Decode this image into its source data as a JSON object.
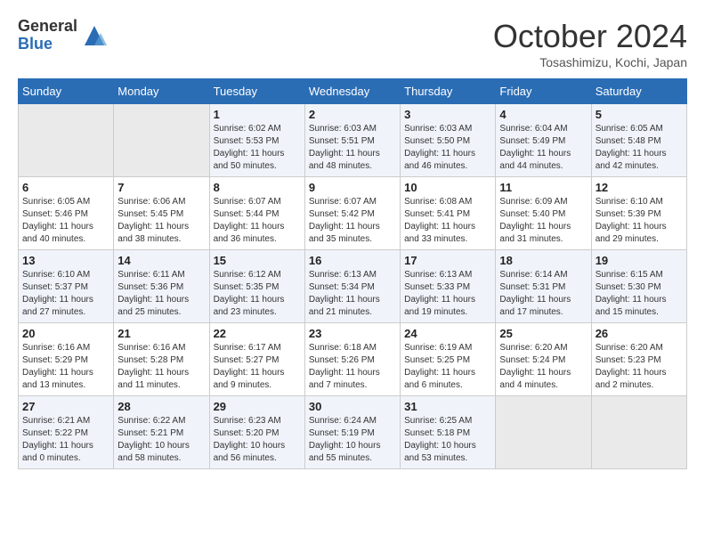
{
  "logo": {
    "general": "General",
    "blue": "Blue"
  },
  "title": "October 2024",
  "location": "Tosashimizu, Kochi, Japan",
  "days_of_week": [
    "Sunday",
    "Monday",
    "Tuesday",
    "Wednesday",
    "Thursday",
    "Friday",
    "Saturday"
  ],
  "weeks": [
    [
      {
        "day": "",
        "empty": true
      },
      {
        "day": "",
        "empty": true
      },
      {
        "day": "1",
        "sunrise": "Sunrise: 6:02 AM",
        "sunset": "Sunset: 5:53 PM",
        "daylight": "Daylight: 11 hours and 50 minutes."
      },
      {
        "day": "2",
        "sunrise": "Sunrise: 6:03 AM",
        "sunset": "Sunset: 5:51 PM",
        "daylight": "Daylight: 11 hours and 48 minutes."
      },
      {
        "day": "3",
        "sunrise": "Sunrise: 6:03 AM",
        "sunset": "Sunset: 5:50 PM",
        "daylight": "Daylight: 11 hours and 46 minutes."
      },
      {
        "day": "4",
        "sunrise": "Sunrise: 6:04 AM",
        "sunset": "Sunset: 5:49 PM",
        "daylight": "Daylight: 11 hours and 44 minutes."
      },
      {
        "day": "5",
        "sunrise": "Sunrise: 6:05 AM",
        "sunset": "Sunset: 5:48 PM",
        "daylight": "Daylight: 11 hours and 42 minutes."
      }
    ],
    [
      {
        "day": "6",
        "sunrise": "Sunrise: 6:05 AM",
        "sunset": "Sunset: 5:46 PM",
        "daylight": "Daylight: 11 hours and 40 minutes."
      },
      {
        "day": "7",
        "sunrise": "Sunrise: 6:06 AM",
        "sunset": "Sunset: 5:45 PM",
        "daylight": "Daylight: 11 hours and 38 minutes."
      },
      {
        "day": "8",
        "sunrise": "Sunrise: 6:07 AM",
        "sunset": "Sunset: 5:44 PM",
        "daylight": "Daylight: 11 hours and 36 minutes."
      },
      {
        "day": "9",
        "sunrise": "Sunrise: 6:07 AM",
        "sunset": "Sunset: 5:42 PM",
        "daylight": "Daylight: 11 hours and 35 minutes."
      },
      {
        "day": "10",
        "sunrise": "Sunrise: 6:08 AM",
        "sunset": "Sunset: 5:41 PM",
        "daylight": "Daylight: 11 hours and 33 minutes."
      },
      {
        "day": "11",
        "sunrise": "Sunrise: 6:09 AM",
        "sunset": "Sunset: 5:40 PM",
        "daylight": "Daylight: 11 hours and 31 minutes."
      },
      {
        "day": "12",
        "sunrise": "Sunrise: 6:10 AM",
        "sunset": "Sunset: 5:39 PM",
        "daylight": "Daylight: 11 hours and 29 minutes."
      }
    ],
    [
      {
        "day": "13",
        "sunrise": "Sunrise: 6:10 AM",
        "sunset": "Sunset: 5:37 PM",
        "daylight": "Daylight: 11 hours and 27 minutes."
      },
      {
        "day": "14",
        "sunrise": "Sunrise: 6:11 AM",
        "sunset": "Sunset: 5:36 PM",
        "daylight": "Daylight: 11 hours and 25 minutes."
      },
      {
        "day": "15",
        "sunrise": "Sunrise: 6:12 AM",
        "sunset": "Sunset: 5:35 PM",
        "daylight": "Daylight: 11 hours and 23 minutes."
      },
      {
        "day": "16",
        "sunrise": "Sunrise: 6:13 AM",
        "sunset": "Sunset: 5:34 PM",
        "daylight": "Daylight: 11 hours and 21 minutes."
      },
      {
        "day": "17",
        "sunrise": "Sunrise: 6:13 AM",
        "sunset": "Sunset: 5:33 PM",
        "daylight": "Daylight: 11 hours and 19 minutes."
      },
      {
        "day": "18",
        "sunrise": "Sunrise: 6:14 AM",
        "sunset": "Sunset: 5:31 PM",
        "daylight": "Daylight: 11 hours and 17 minutes."
      },
      {
        "day": "19",
        "sunrise": "Sunrise: 6:15 AM",
        "sunset": "Sunset: 5:30 PM",
        "daylight": "Daylight: 11 hours and 15 minutes."
      }
    ],
    [
      {
        "day": "20",
        "sunrise": "Sunrise: 6:16 AM",
        "sunset": "Sunset: 5:29 PM",
        "daylight": "Daylight: 11 hours and 13 minutes."
      },
      {
        "day": "21",
        "sunrise": "Sunrise: 6:16 AM",
        "sunset": "Sunset: 5:28 PM",
        "daylight": "Daylight: 11 hours and 11 minutes."
      },
      {
        "day": "22",
        "sunrise": "Sunrise: 6:17 AM",
        "sunset": "Sunset: 5:27 PM",
        "daylight": "Daylight: 11 hours and 9 minutes."
      },
      {
        "day": "23",
        "sunrise": "Sunrise: 6:18 AM",
        "sunset": "Sunset: 5:26 PM",
        "daylight": "Daylight: 11 hours and 7 minutes."
      },
      {
        "day": "24",
        "sunrise": "Sunrise: 6:19 AM",
        "sunset": "Sunset: 5:25 PM",
        "daylight": "Daylight: 11 hours and 6 minutes."
      },
      {
        "day": "25",
        "sunrise": "Sunrise: 6:20 AM",
        "sunset": "Sunset: 5:24 PM",
        "daylight": "Daylight: 11 hours and 4 minutes."
      },
      {
        "day": "26",
        "sunrise": "Sunrise: 6:20 AM",
        "sunset": "Sunset: 5:23 PM",
        "daylight": "Daylight: 11 hours and 2 minutes."
      }
    ],
    [
      {
        "day": "27",
        "sunrise": "Sunrise: 6:21 AM",
        "sunset": "Sunset: 5:22 PM",
        "daylight": "Daylight: 11 hours and 0 minutes."
      },
      {
        "day": "28",
        "sunrise": "Sunrise: 6:22 AM",
        "sunset": "Sunset: 5:21 PM",
        "daylight": "Daylight: 10 hours and 58 minutes."
      },
      {
        "day": "29",
        "sunrise": "Sunrise: 6:23 AM",
        "sunset": "Sunset: 5:20 PM",
        "daylight": "Daylight: 10 hours and 56 minutes."
      },
      {
        "day": "30",
        "sunrise": "Sunrise: 6:24 AM",
        "sunset": "Sunset: 5:19 PM",
        "daylight": "Daylight: 10 hours and 55 minutes."
      },
      {
        "day": "31",
        "sunrise": "Sunrise: 6:25 AM",
        "sunset": "Sunset: 5:18 PM",
        "daylight": "Daylight: 10 hours and 53 minutes."
      },
      {
        "day": "",
        "empty": true
      },
      {
        "day": "",
        "empty": true
      }
    ]
  ]
}
